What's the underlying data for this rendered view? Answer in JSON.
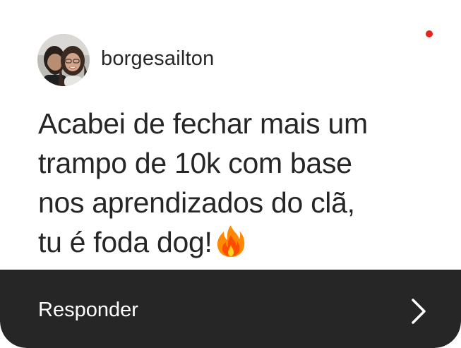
{
  "notification": {
    "user": {
      "username": "borgesailton"
    },
    "message": {
      "lines": [
        "Acabei de fechar mais um",
        "trampo de 10k com base",
        "nos aprendizados do clã,",
        "tu é foda dog!"
      ],
      "trailing_icon": "fire-emoji-icon"
    },
    "reply": {
      "label": "Responder",
      "icon": "chevron-right-icon"
    },
    "colors": {
      "text": "#262626",
      "reply_bar": "#262626",
      "reply_text": "#ffffff",
      "unread_dot": "#e8221c",
      "background": "#ffffff"
    }
  }
}
